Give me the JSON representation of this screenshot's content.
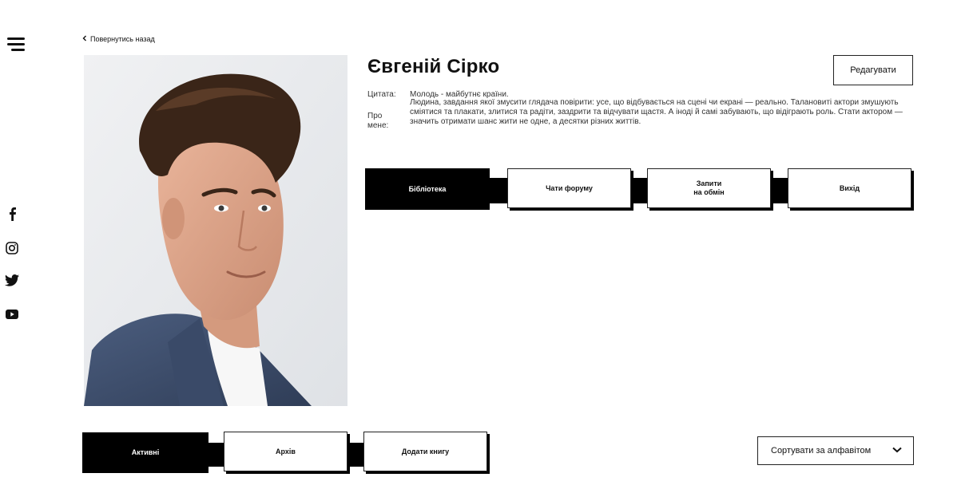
{
  "nav": {
    "back_label": "Повернутись назад"
  },
  "left_rail": {
    "menu_icon": "hamburger-menu-icon",
    "social": [
      "facebook-icon",
      "instagram-icon",
      "twitter-icon",
      "youtube-icon"
    ]
  },
  "profile": {
    "name": "Євгеній Сірко",
    "edit_label": "Редагувати",
    "quote_label": "Цитата:",
    "quote_text": "Молодь - майбутнє країни.",
    "about_label": "Про мене:",
    "about_text": "Людина, завдання якої змусити глядача повірити: усе, що відбувається на сцені чи екрані — реально. Талановиті актори змушують сміятися та плакати, злитися та радіти, заздрити та відчувати щастя. А іноді й самі забувають, що відіграють роль. Стати актором — значить отримати шанс жити не одне, а десятки різних життів."
  },
  "main_tabs": [
    {
      "label": "Бібліотека",
      "active": true
    },
    {
      "label": "Чати форуму",
      "active": false
    },
    {
      "label": "Запити\nна обмін",
      "active": false
    },
    {
      "label": "Вихід",
      "active": false
    }
  ],
  "book_tabs": [
    {
      "label": "Активні",
      "active": true
    },
    {
      "label": "Архів",
      "active": false
    },
    {
      "label": "Додати книгу",
      "active": false
    }
  ],
  "sort": {
    "label": "Сортувати за алфавітом"
  },
  "colors": {
    "accent": "#000000",
    "background": "#ffffff",
    "text": "#111111"
  }
}
